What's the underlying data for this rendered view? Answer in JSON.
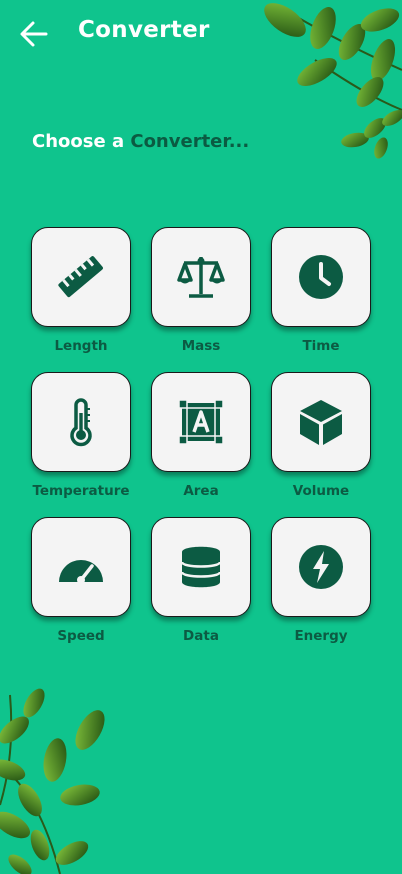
{
  "appbar": {
    "title": "Converter",
    "back_icon": "arrow-left-icon"
  },
  "prompt": {
    "lead": "Choose a ",
    "accent": "Converter..."
  },
  "colors": {
    "background": "#0fc48d",
    "accent": "#0b5b42",
    "card": "#f4f4f4"
  },
  "converters": [
    {
      "label": "Length",
      "icon": "ruler-icon"
    },
    {
      "label": "Mass",
      "icon": "scale-icon"
    },
    {
      "label": "Time",
      "icon": "clock-icon"
    },
    {
      "label": "Temperature",
      "icon": "thermometer-icon"
    },
    {
      "label": "Area",
      "icon": "area-icon"
    },
    {
      "label": "Volume",
      "icon": "cube-icon"
    },
    {
      "label": "Speed",
      "icon": "speedometer-icon"
    },
    {
      "label": "Data",
      "icon": "database-icon"
    },
    {
      "label": "Energy",
      "icon": "lightning-icon"
    }
  ]
}
